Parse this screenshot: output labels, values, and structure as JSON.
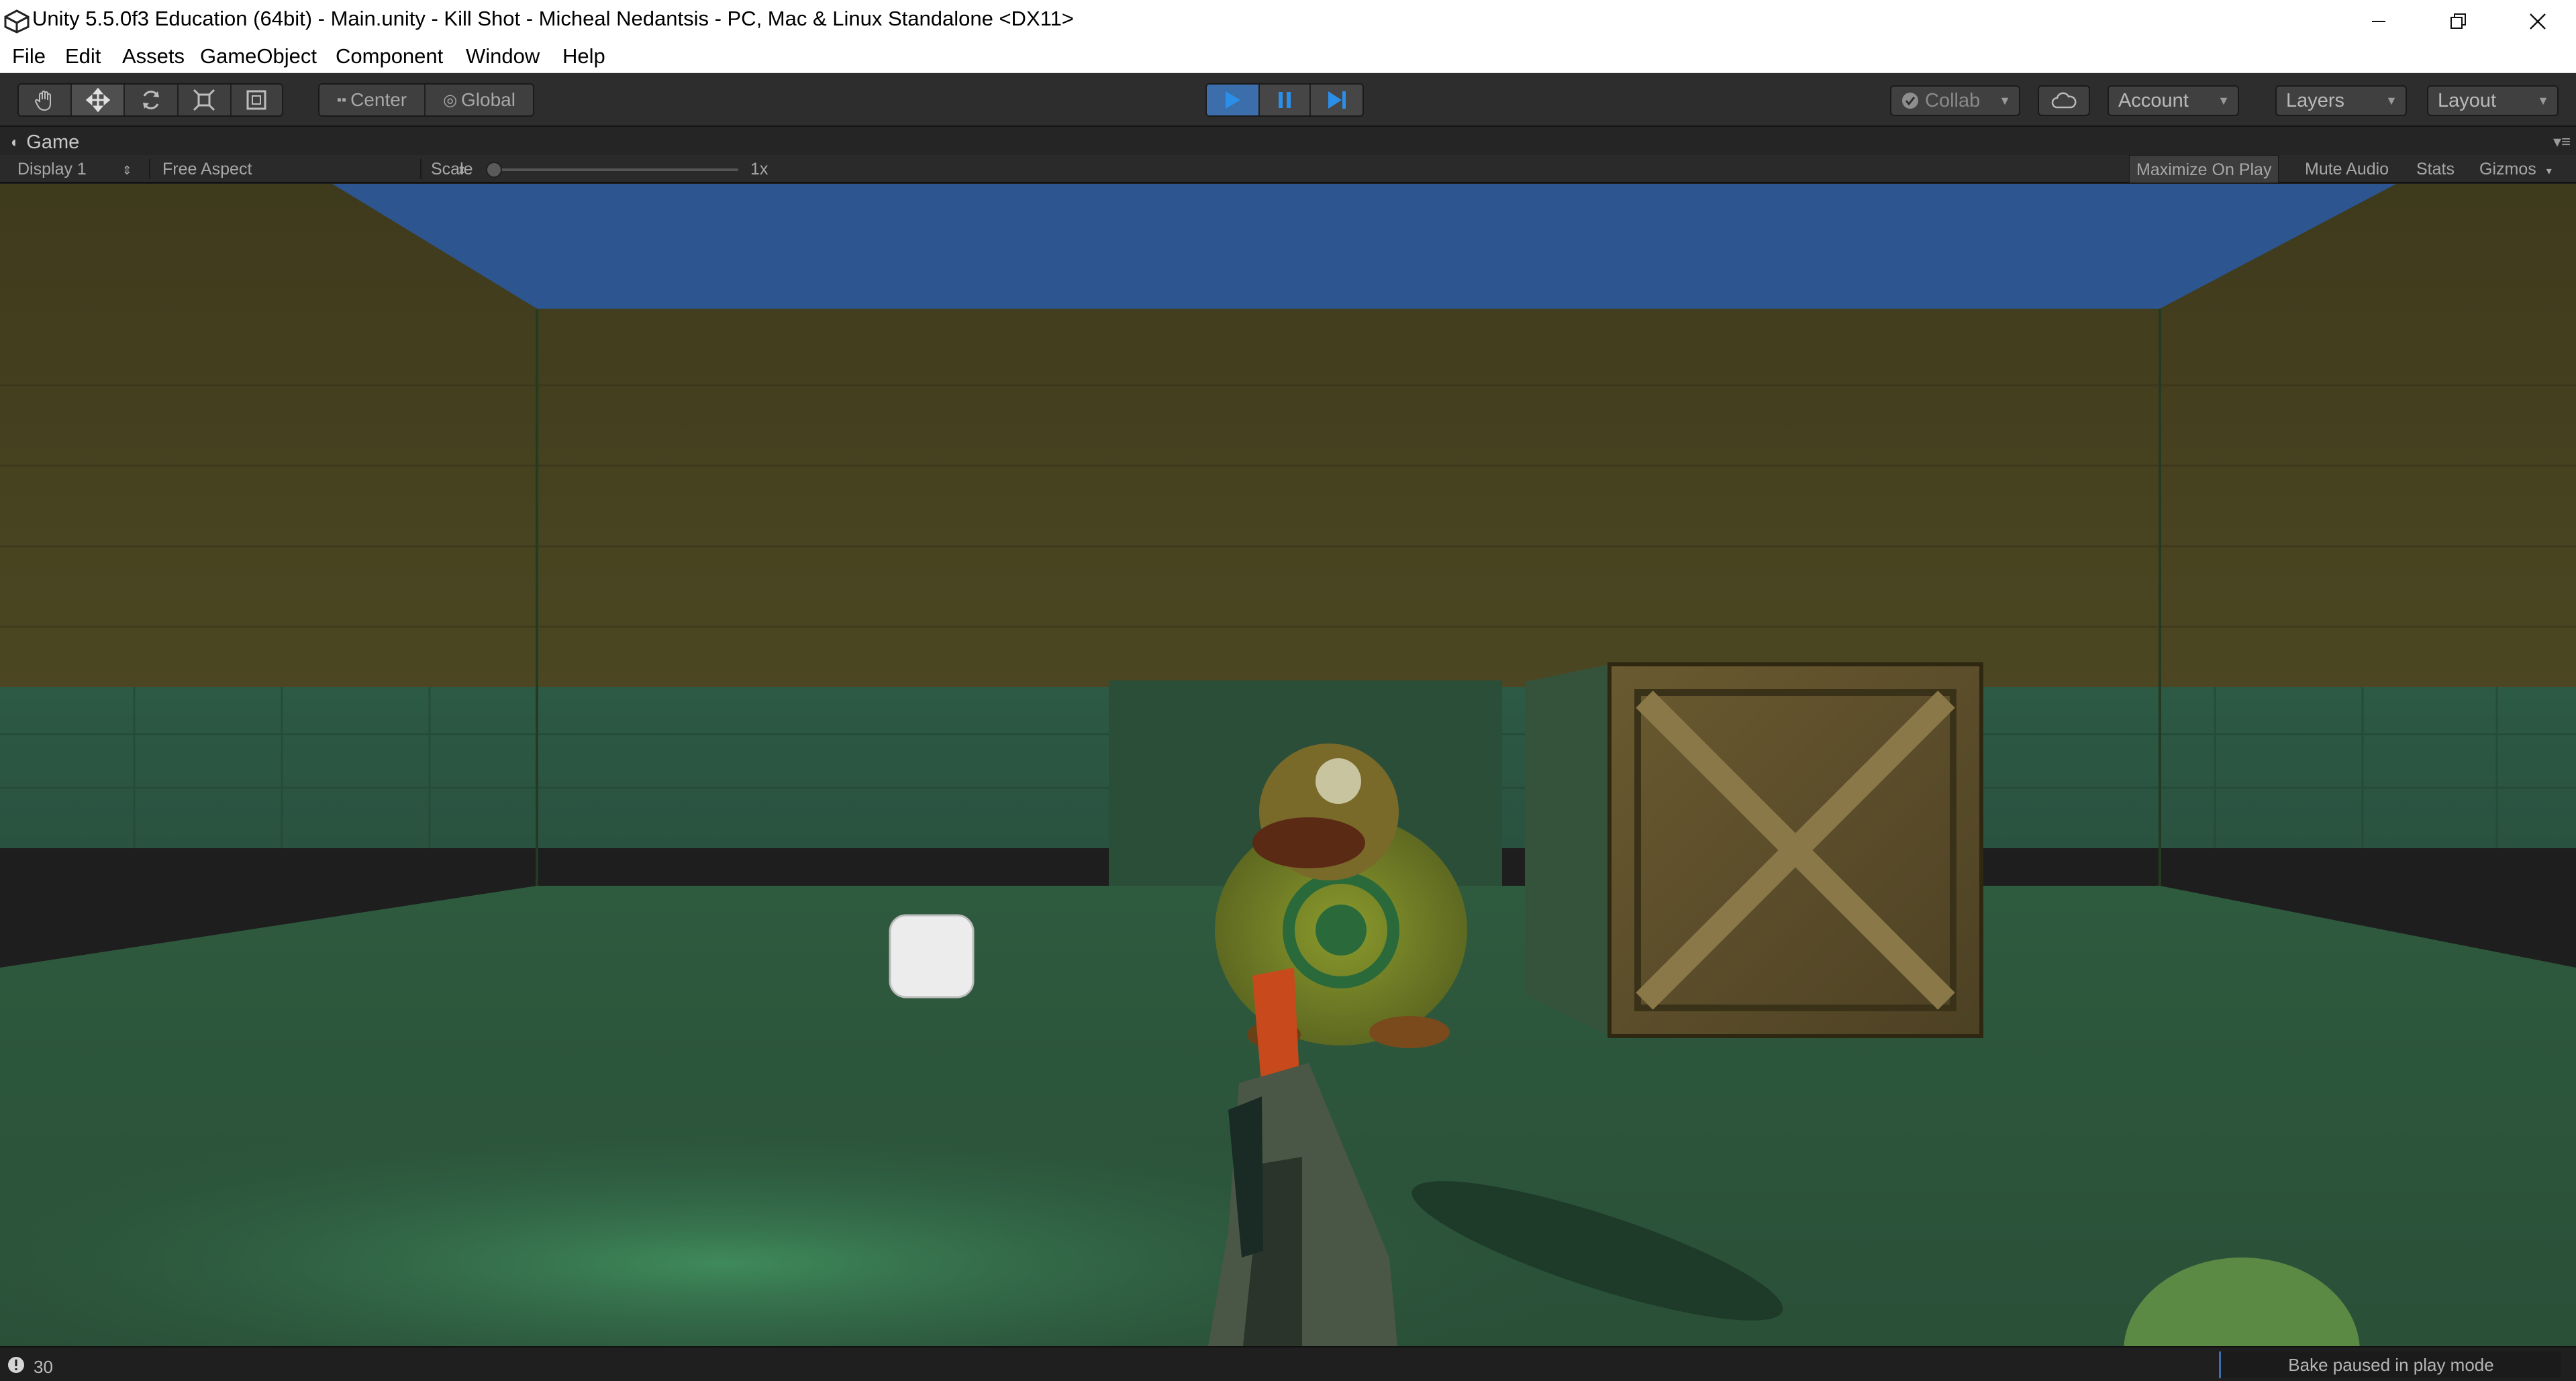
{
  "window": {
    "title": "Unity 5.5.0f3 Education (64bit) - Main.unity - Kill Shot - Micheal Nedantsis - PC, Mac & Linux Standalone <DX11>",
    "buttons": [
      "minimize-icon",
      "restore-icon",
      "close-icon"
    ]
  },
  "menu": {
    "items": [
      "File",
      "Edit",
      "Assets",
      "GameObject",
      "Component",
      "Window",
      "Help"
    ]
  },
  "toolbar": {
    "transform_tools": [
      "hand-icon",
      "move-icon",
      "rotate-icon",
      "scale-icon",
      "rect-tool-icon"
    ],
    "pivot_label": "Center",
    "space_label": "Global",
    "play_controls": [
      "play-icon",
      "pause-icon",
      "step-icon"
    ],
    "collab_label": "Collab",
    "account_label": "Account",
    "layers_label": "Layers",
    "layout_label": "Layout"
  },
  "game_view": {
    "tab_label": "Game",
    "display_label": "Display 1",
    "aspect_label": "Free Aspect",
    "scale_label": "Scale",
    "scale_value": "1x",
    "maximize_label": "Maximize On Play",
    "maximize_on": true,
    "mute_label": "Mute Audio",
    "stats_label": "Stats",
    "gizmos_label": "Gizmos"
  },
  "status": {
    "message_count": "30",
    "bake_text": "Bake paused in play mode"
  },
  "colors": {
    "play_active": "#3b6eaa",
    "sky": "#2d5590",
    "wall_upper": "#4a4320",
    "wall_lower": "#2c5a40",
    "floor": "#2f5a3c"
  }
}
